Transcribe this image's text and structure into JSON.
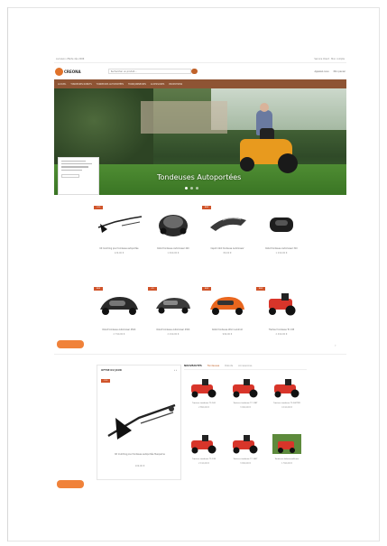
{
  "topbar": {
    "left": "Livraison offerte dès 200€",
    "right": "Service Client · Mon compte"
  },
  "header": {
    "logo_text": "CREONA",
    "search_placeholder": "Rechercher un produit...",
    "cart_label": "Mon panier",
    "phone_label": "Appelez-nous"
  },
  "nav": {
    "items": [
      "ACCUEIL",
      "TONDEUSES ROBOTS",
      "TONDEUSES AUTOPORTÉES",
      "TRONÇONNEUSES",
      "ACCESSOIRES",
      "PROMOTIONS"
    ]
  },
  "hero": {
    "title": "Tondeuses Autoportées",
    "card_button": "Voir"
  },
  "products": [
    {
      "name": "Kit mulching pour tondeuse autoportée",
      "price": "129,00 €",
      "badge": "-10%"
    },
    {
      "name": "Robot tondeuse Automower 420",
      "price": "1 690,00 €",
      "badge": ""
    },
    {
      "name": "Capot robot tondeuse Automower",
      "price": "89,00 €",
      "badge": "NEW"
    },
    {
      "name": "Robot tondeuse Automower 310",
      "price": "1 290,00 €",
      "badge": ""
    },
    {
      "name": "Robot tondeuse Automower 450X",
      "price": "2 790,00 €",
      "badge": "NEW"
    },
    {
      "name": "Robot tondeuse Automower 430X",
      "price": "2 290,00 €",
      "badge": "-5%"
    },
    {
      "name": "Robot tondeuse Worx Landroid",
      "price": "999,00 €",
      "badge": "NEW"
    },
    {
      "name": "Tracteur tondeuse TC 138",
      "price": "2 490,00 €",
      "badge": "NEW"
    }
  ],
  "featured": {
    "title": "OFFRE DU JOUR",
    "nav": "‹ ›",
    "badge": "-15%",
    "name": "Kit mulching pour tondeuse autoportée Husqvarna",
    "price": "109,00 €"
  },
  "new_products": {
    "title": "NOUVEAUTÉS",
    "tabs": [
      "Tondeuses",
      "Robots",
      "Accessoires"
    ],
    "items": [
      {
        "name": "Tracteur tondeuse TS 142",
        "price": "2 890,00 €"
      },
      {
        "name": "Tracteur tondeuse TC 238T",
        "price": "3 490,00 €"
      },
      {
        "name": "Tracteur tondeuse TS 242TXD",
        "price": "4 190,00 €"
      },
      {
        "name": "Tracteur tondeuse TS 138",
        "price": "2 190,00 €"
      },
      {
        "name": "Tracteur tondeuse TC 242T",
        "price": "3 990,00 €"
      },
      {
        "name": "Tondeuse débroussailleuse",
        "price": "1 590,00 €"
      }
    ]
  },
  "colors": {
    "nav": "#8e5434",
    "accent": "#f0823a",
    "badge": "#d0542a",
    "mower": "#d8352a"
  },
  "scroll_arrow": "›"
}
